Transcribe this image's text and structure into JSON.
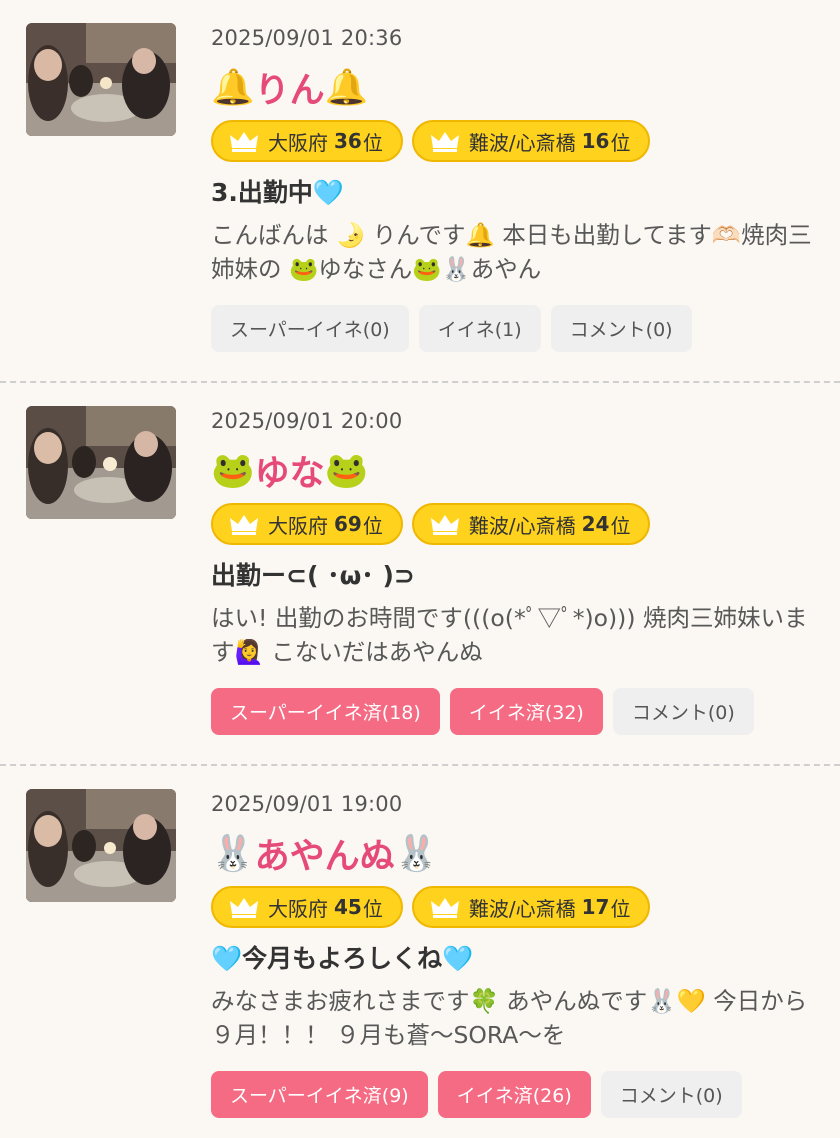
{
  "posts": [
    {
      "timestamp": "2025/09/01 20:36",
      "name_prefix": "🔔",
      "name": "りん",
      "name_suffix": "🔔",
      "ranks": [
        {
          "region": "大阪府",
          "rank": "36",
          "unit": "位"
        },
        {
          "region": "難波/心斎橋",
          "rank": "16",
          "unit": "位"
        }
      ],
      "headline": "3.出勤中🩵",
      "body": "こんばんは 🌛 りんです🔔 本日も出勤してます🫶🏻焼肉三姉妹の 🐸ゆなさん🐸🐰あやん",
      "buttons": [
        {
          "label": "スーパーイイネ(0)",
          "active": false
        },
        {
          "label": "イイネ(1)",
          "active": false
        },
        {
          "label": "コメント(0)",
          "active": false
        }
      ]
    },
    {
      "timestamp": "2025/09/01 20:00",
      "name_prefix": "🐸",
      "name": "ゆな",
      "name_suffix": "🐸",
      "ranks": [
        {
          "region": "大阪府",
          "rank": "69",
          "unit": "位"
        },
        {
          "region": "難波/心斎橋",
          "rank": "24",
          "unit": "位"
        }
      ],
      "headline": "出勤ー⊂( ･ω･ )⊃",
      "body": "はい! 出勤のお時間です(((o(*ﾟ▽ﾟ*)o))) 焼肉三姉妹います🙋‍♀️ こないだはあやんぬ",
      "buttons": [
        {
          "label": "スーパーイイネ済(18)",
          "active": true
        },
        {
          "label": "イイネ済(32)",
          "active": true
        },
        {
          "label": "コメント(0)",
          "active": false
        }
      ]
    },
    {
      "timestamp": "2025/09/01 19:00",
      "name_prefix": "🐰 ",
      "name": "あやんぬ",
      "name_suffix": " 🐰",
      "ranks": [
        {
          "region": "大阪府",
          "rank": "45",
          "unit": "位"
        },
        {
          "region": "難波/心斎橋",
          "rank": "17",
          "unit": "位"
        }
      ],
      "headline": "🩵今月もよろしくね🩵",
      "body": "みなさまお疲れさまです🍀 あやんぬです🐰💛 今日から９月！！！ ９月も蒼〜SORA〜を",
      "buttons": [
        {
          "label": "スーパーイイネ済(9)",
          "active": true
        },
        {
          "label": "イイネ済(26)",
          "active": true
        },
        {
          "label": "コメント(0)",
          "active": false
        }
      ]
    }
  ],
  "colors": {
    "background": "#fbf8f3",
    "name_pink": "#e64a78",
    "badge_yellow": "#ffd21e",
    "liked_button": "#f46b83",
    "default_button": "#efefef"
  }
}
